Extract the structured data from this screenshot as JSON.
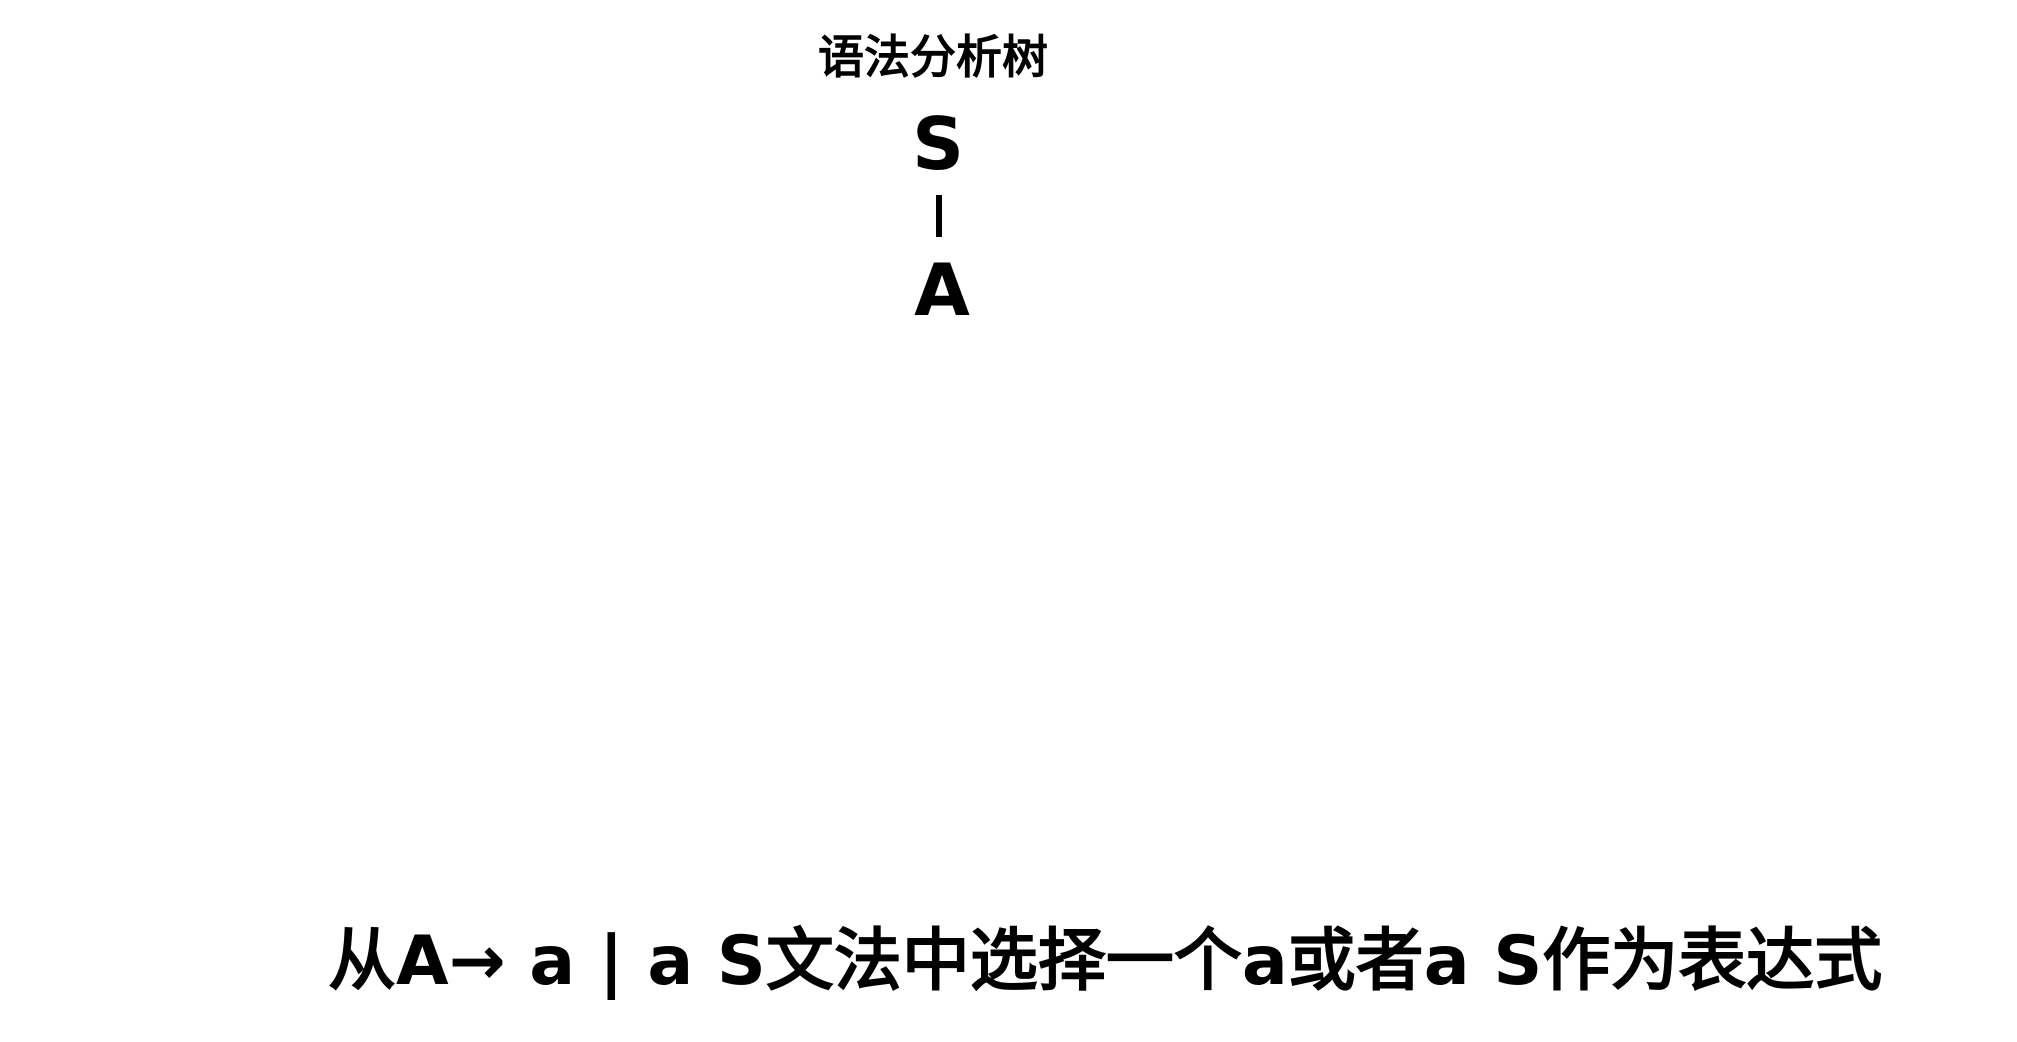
{
  "diagram": {
    "title": "语法分析树",
    "tree": {
      "root": "S",
      "child": "A"
    },
    "caption": "从A→ a | a S文法中选择一个a或者a S作为表达式"
  }
}
